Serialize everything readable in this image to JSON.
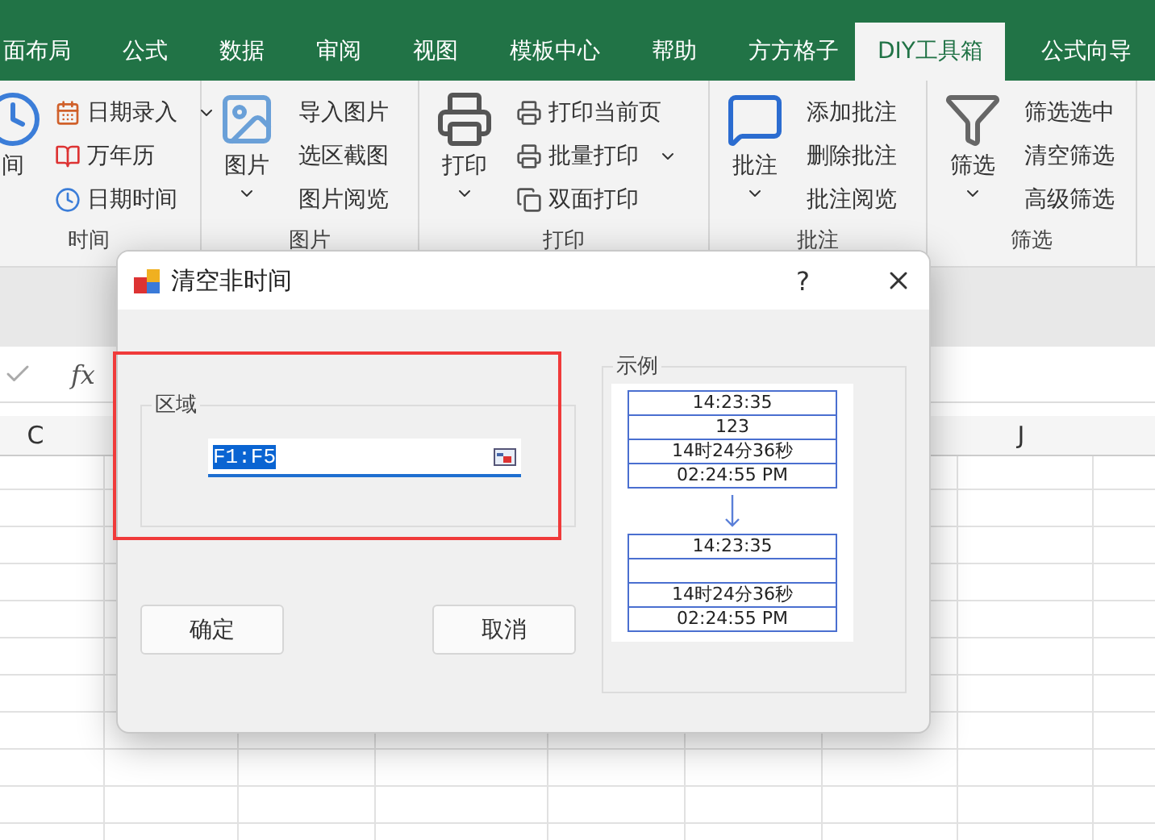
{
  "tabs": [
    {
      "label": "面布局",
      "selected": false
    },
    {
      "label": "公式",
      "selected": false
    },
    {
      "label": "数据",
      "selected": false
    },
    {
      "label": "审阅",
      "selected": false
    },
    {
      "label": "视图",
      "selected": false
    },
    {
      "label": "模板中心",
      "selected": false
    },
    {
      "label": "帮助",
      "selected": false
    },
    {
      "label": "方方格子",
      "selected": false
    },
    {
      "label": "DIY工具箱",
      "selected": true
    },
    {
      "label": "公式向导",
      "selected": false
    }
  ],
  "ribbon_groups": [
    {
      "label": "时间",
      "big": {
        "label": "间",
        "caret": false
      },
      "items": [
        {
          "label": "日期录入",
          "dropdown": true
        },
        {
          "label": "万年历",
          "dropdown": false
        },
        {
          "label": "日期时间",
          "dropdown": false
        }
      ]
    },
    {
      "label": "图片",
      "big": {
        "label": "图片",
        "caret": true
      },
      "items": [
        {
          "label": "导入图片",
          "dropdown": false
        },
        {
          "label": "选区截图",
          "dropdown": false
        },
        {
          "label": "图片阅览",
          "dropdown": false
        }
      ]
    },
    {
      "label": "打印",
      "big": {
        "label": "打印",
        "caret": true
      },
      "items": [
        {
          "label": "打印当前页",
          "dropdown": false
        },
        {
          "label": "批量打印",
          "dropdown": true
        },
        {
          "label": "双面打印",
          "dropdown": false
        }
      ]
    },
    {
      "label": "批注",
      "big": {
        "label": "批注",
        "caret": true
      },
      "items": [
        {
          "label": "添加批注",
          "dropdown": false
        },
        {
          "label": "删除批注",
          "dropdown": false
        },
        {
          "label": "批注阅览",
          "dropdown": false
        }
      ]
    },
    {
      "label": "筛选",
      "big": {
        "label": "筛选",
        "caret": true
      },
      "items": [
        {
          "label": "筛选选中",
          "dropdown": false
        },
        {
          "label": "清空筛选",
          "dropdown": false
        },
        {
          "label": "高级筛选",
          "dropdown": false
        }
      ]
    }
  ],
  "formula_bar": {
    "function_label": "fx"
  },
  "column_headers": [
    {
      "label": "C"
    },
    {
      "label": "J"
    }
  ],
  "dialog": {
    "title": "清空非时间",
    "help": "?",
    "range_group": {
      "label": "区域",
      "value": "F1:F5",
      "selected": true
    },
    "buttons": [
      {
        "label": "确定"
      },
      {
        "label": "取消"
      }
    ],
    "example": {
      "label": "示例",
      "before": [
        {
          "kind": "value",
          "text": "14:23:35"
        },
        {
          "kind": "value",
          "text": "123"
        },
        {
          "kind": "value",
          "text": "14时24分36秒"
        },
        {
          "kind": "value",
          "text": "02:24:55 PM"
        }
      ],
      "after": [
        {
          "kind": "value",
          "text": "14:23:35"
        },
        {
          "kind": "blank"
        },
        {
          "kind": "value",
          "text": "14时24分36秒"
        },
        {
          "kind": "value",
          "text": "02:24:55 PM"
        }
      ]
    }
  }
}
